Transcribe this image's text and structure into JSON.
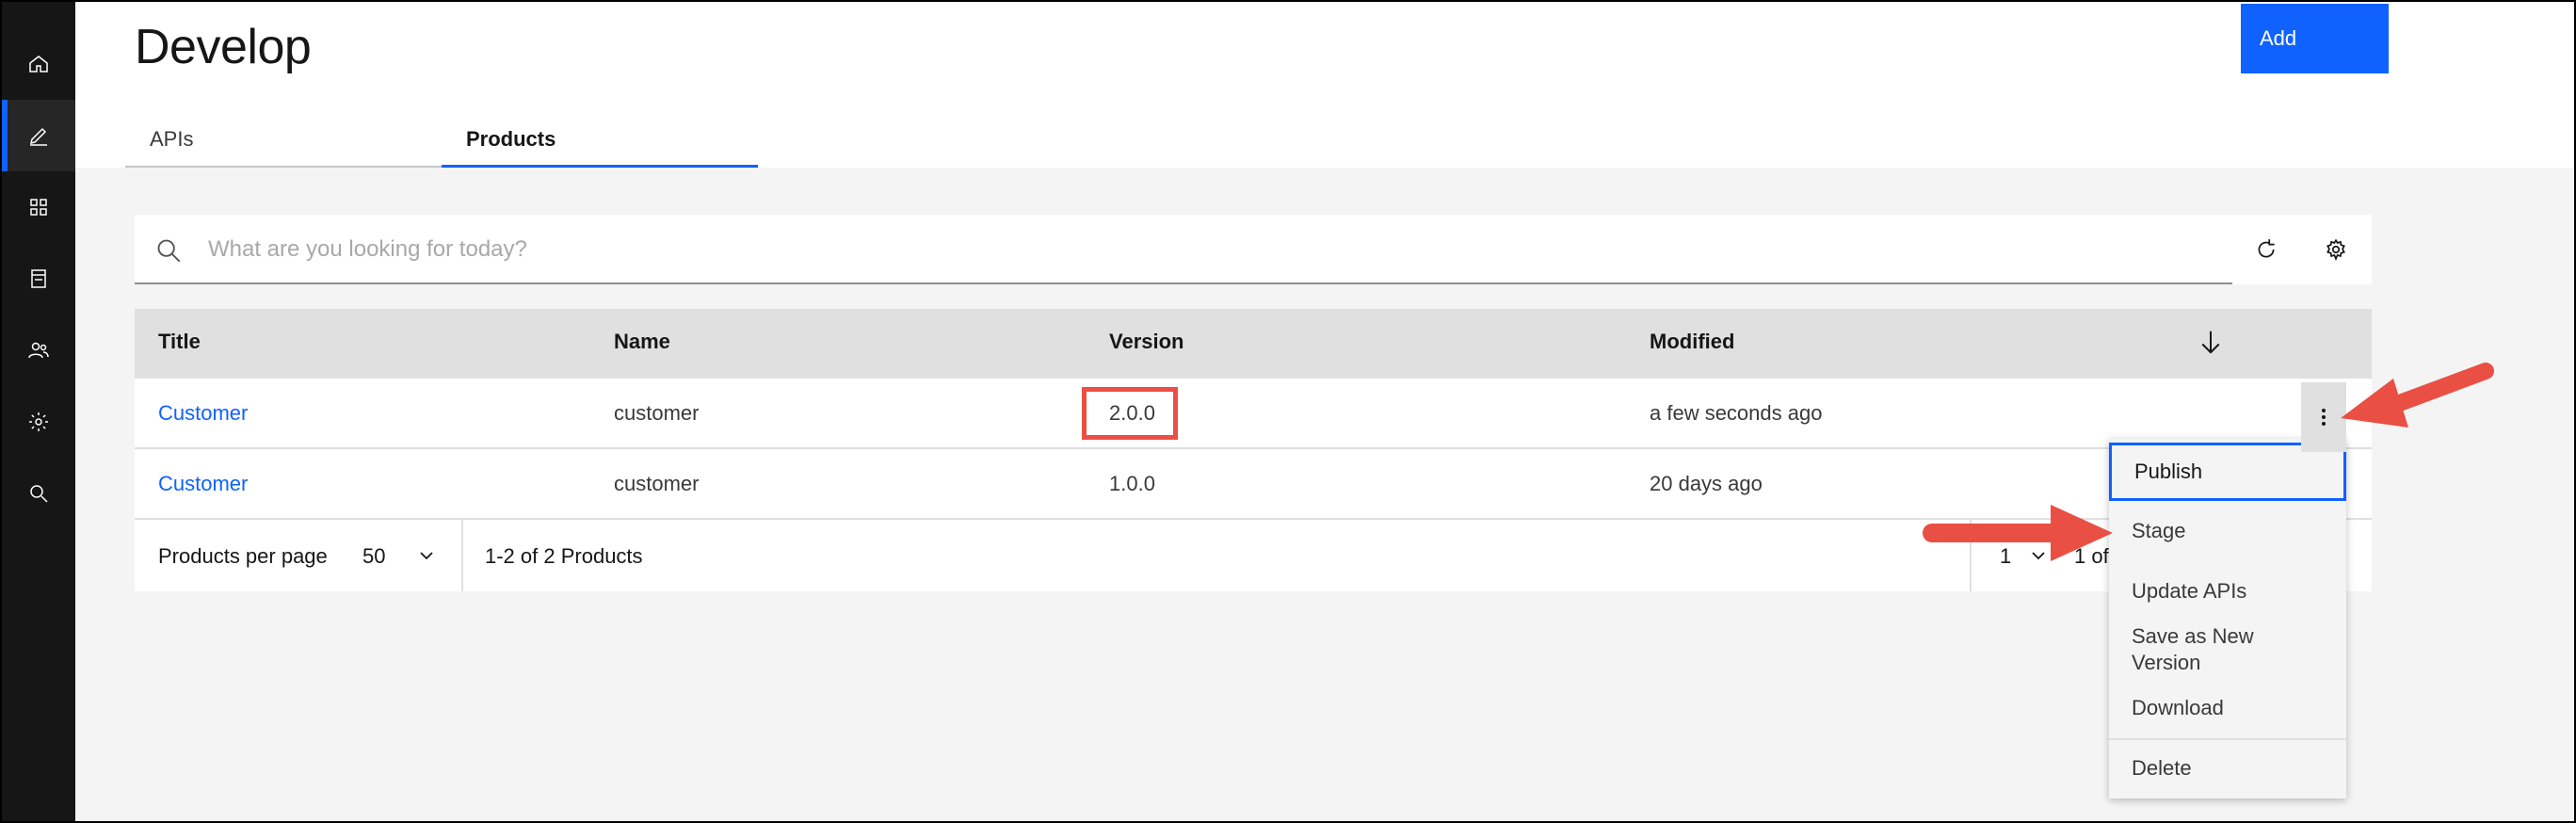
{
  "page": {
    "title": "Develop",
    "add_label": "Add"
  },
  "tabs": [
    {
      "label": "APIs",
      "selected": false
    },
    {
      "label": "Products",
      "selected": true
    }
  ],
  "nav": [
    {
      "icon": "home-icon"
    },
    {
      "icon": "edit-icon",
      "active": true
    },
    {
      "icon": "apps-icon"
    },
    {
      "icon": "catalog-icon"
    },
    {
      "icon": "user-group-icon"
    },
    {
      "icon": "settings-icon"
    },
    {
      "icon": "search-icon"
    }
  ],
  "search": {
    "placeholder": "What are you looking for today?",
    "value": ""
  },
  "table": {
    "headers": [
      "Title",
      "Name",
      "Version",
      "Modified"
    ],
    "rows": [
      {
        "title": "Customer",
        "name": "customer",
        "version": "2.0.0",
        "modified": "a few seconds ago"
      },
      {
        "title": "Customer",
        "name": "customer",
        "version": "1.0.0",
        "modified": "20 days ago"
      }
    ]
  },
  "pagination": {
    "per_page_label": "Products per page",
    "per_page_value": "50",
    "range_label": "1-2 of 2 Products",
    "page_value": "1",
    "page_of_label": "1 of"
  },
  "menu": {
    "items": [
      "Publish",
      "Stage",
      "Update APIs",
      "Save as New Version",
      "Download",
      "Delete"
    ]
  },
  "colors": {
    "accent": "#0f62fe",
    "annotation": "#ea4f43",
    "rail": "#161616"
  }
}
